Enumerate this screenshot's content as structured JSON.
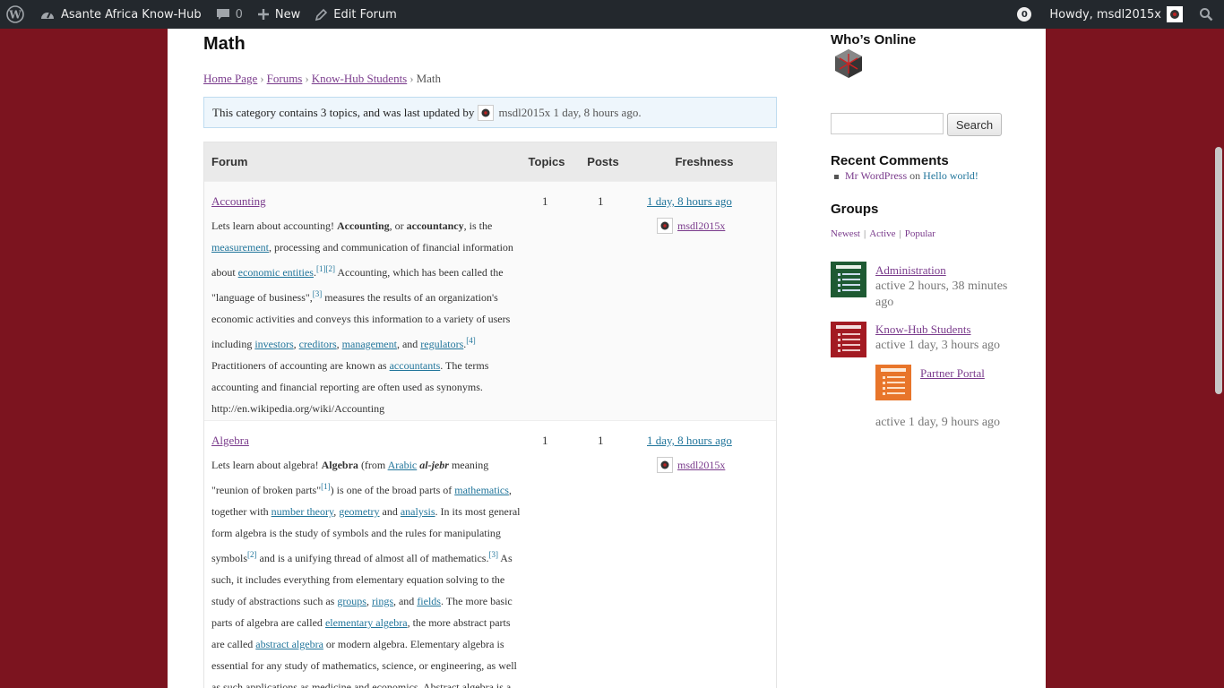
{
  "adminbar": {
    "site_name": "Asante Africa Know-Hub",
    "comments_count": "0",
    "new_label": "New",
    "edit_label": "Edit Forum",
    "notifications_count": "0",
    "howdy": "Howdy, msdl2015x"
  },
  "page": {
    "title": "Math",
    "breadcrumb": [
      "Home Page",
      "Forums",
      "Know-Hub Students",
      "Math"
    ],
    "breadcrumb_sep": "›",
    "notice": {
      "prefix": "This category contains 3 topics, and was last updated by",
      "user": "msdl2015x",
      "suffix": "1 day, 8 hours ago."
    }
  },
  "table": {
    "headers": {
      "forum": "Forum",
      "topics": "Topics",
      "posts": "Posts",
      "freshness": "Freshness"
    },
    "rows": [
      {
        "title": "Accounting",
        "topics": "1",
        "posts": "1",
        "freshness": "1 day, 8 hours ago",
        "author": "msdl2015x"
      },
      {
        "title": "Algebra",
        "topics": "1",
        "posts": "1",
        "freshness": "1 day, 8 hours ago",
        "author": "msdl2015x"
      }
    ]
  },
  "sidebar": {
    "whos_online": "Who’s Online",
    "search_button": "Search",
    "recent_comments_title": "Recent Comments",
    "recent_comment": {
      "author": "Mr WordPress",
      "on": "on",
      "post": "Hello world!"
    },
    "groups_title": "Groups",
    "group_filters": [
      "Newest",
      "Active",
      "Popular"
    ],
    "groups": [
      {
        "name": "Administration",
        "active": "active 2 hours, 38 minutes ago"
      },
      {
        "name": "Know-Hub Students",
        "active": "active 1 day, 3 hours ago"
      },
      {
        "name": "Partner Portal",
        "active": "active 1 day, 9 hours ago"
      }
    ]
  },
  "colors": {
    "background": "#7c141f",
    "link": "#21759b",
    "visited": "#7a3b8c",
    "adminbar": "#23282d"
  }
}
